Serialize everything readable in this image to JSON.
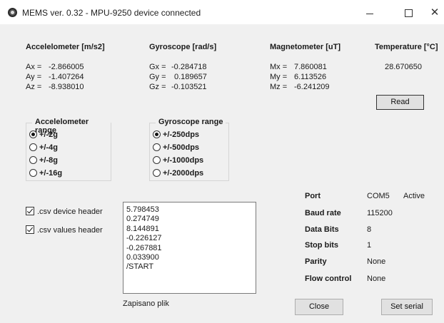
{
  "window": {
    "title": "MEMS ver. 0.32 - MPU-9250 device connected",
    "app_icon": "app-icon",
    "controls": {
      "minimize": "–",
      "maximize": "□",
      "close": "✕"
    }
  },
  "accelerometer": {
    "header": "Accelelometer [m/s2]",
    "rows": [
      {
        "label": "Ax =",
        "value": "-2.866005"
      },
      {
        "label": "Ay =",
        "value": "-1.407264"
      },
      {
        "label": "Az =",
        "value": "-8.938010"
      }
    ]
  },
  "gyroscope": {
    "header": "Gyroscope [rad/s]",
    "rows": [
      {
        "label": "Gx =",
        "value": "-0.284718"
      },
      {
        "label": "Gy =",
        "value": "0.189657"
      },
      {
        "label": "Gz =",
        "value": "-0.103521"
      }
    ]
  },
  "magnetometer": {
    "header": "Magnetometer [uT]",
    "rows": [
      {
        "label": "Mx =",
        "value": "7.860081"
      },
      {
        "label": "My =",
        "value": "6.113526"
      },
      {
        "label": "Mz =",
        "value": "-6.241209"
      }
    ]
  },
  "temperature": {
    "header": "Temperature [°C]",
    "value": "28.670650"
  },
  "read_button": "Read",
  "accel_range": {
    "title": "Accelelometer range",
    "options": [
      "+/-2g",
      "+/-4g",
      "+/-8g",
      "+/-16g"
    ],
    "selected": "+/-2g"
  },
  "gyro_range": {
    "title": "Gyroscope range",
    "options": [
      "+/-250dps",
      "+/-500dps",
      "+/-1000dps",
      "+/-2000dps"
    ],
    "selected": "+/-250dps"
  },
  "checkboxes": {
    "device_header": {
      "label": ".csv device header",
      "checked": true
    },
    "values_header": {
      "label": ".csv values header",
      "checked": true
    }
  },
  "output_lines": [
    "5.798453",
    "0.274749",
    "8.144891",
    "-0.226127",
    "-0.267881",
    "0.033900",
    "/START"
  ],
  "status_text": "Zapisano plik",
  "serial": {
    "port_label": "Port",
    "port_value": "COM5",
    "port_status": "Active",
    "baud_label": "Baud rate",
    "baud_value": "115200",
    "databits_label": "Data Bits",
    "databits_value": "8",
    "stopbits_label": "Stop bits",
    "stopbits_value": "1",
    "parity_label": "Parity",
    "parity_value": "None",
    "flow_label": "Flow control",
    "flow_value": "None"
  },
  "close_button": "Close",
  "set_serial_button": "Set serial"
}
